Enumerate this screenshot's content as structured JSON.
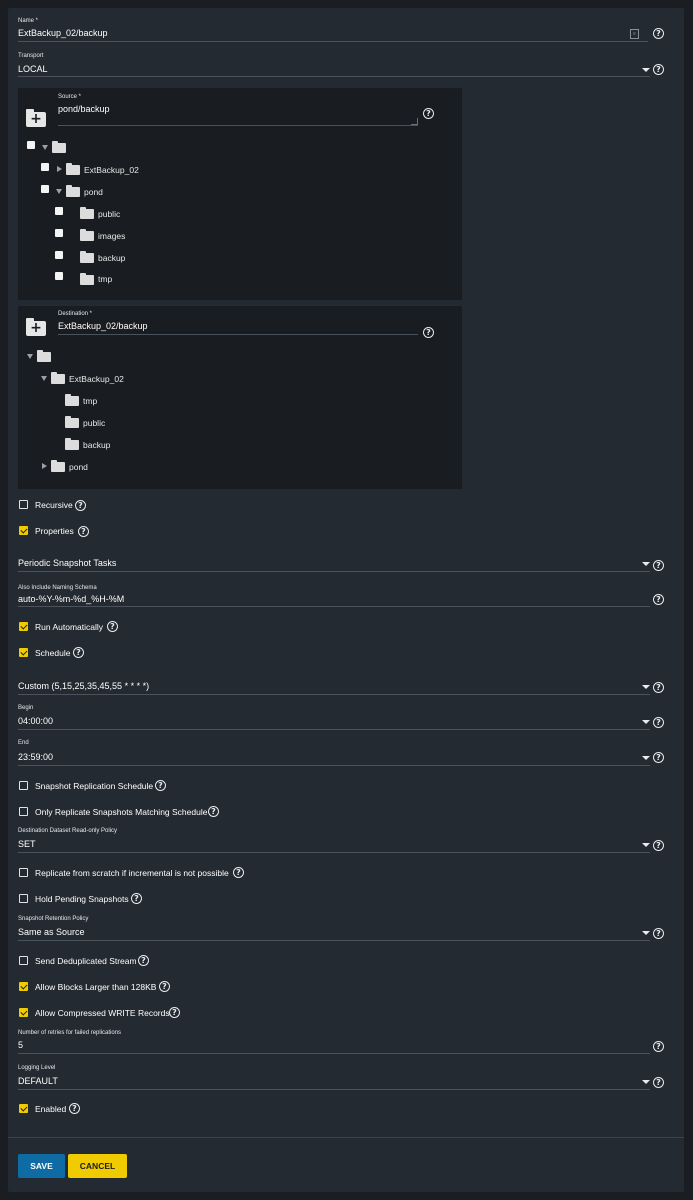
{
  "name": {
    "label": "Name *",
    "value": "ExtBackup_02/backup"
  },
  "transport": {
    "label": "Transport",
    "value": "LOCAL"
  },
  "source": {
    "label": "Source *",
    "value": "pond/backup",
    "tree": {
      "items": [
        "ExtBackup_02",
        "pond",
        "public",
        "images",
        "backup",
        "tmp"
      ]
    }
  },
  "destination": {
    "label": "Destination *",
    "value": "ExtBackup_02/backup",
    "tree": {
      "items": [
        "ExtBackup_02",
        "tmp",
        "public",
        "backup",
        "pond"
      ]
    }
  },
  "recursive": {
    "label": "Recursive",
    "checked": false
  },
  "properties": {
    "label": "Properties",
    "checked": true
  },
  "periodic_snapshot_tasks": {
    "placeholder": "Periodic Snapshot Tasks"
  },
  "naming_schema": {
    "label": "Also Include Naming Schema",
    "value": "auto-%Y-%m-%d_%H-%M"
  },
  "run_automatically": {
    "label": "Run Automatically",
    "checked": true
  },
  "schedule": {
    "label": "Schedule",
    "checked": true
  },
  "schedule_preset": {
    "value": "Custom (5,15,25,35,45,55 * * * *)"
  },
  "begin": {
    "label": "Begin",
    "value": "04:00:00"
  },
  "end": {
    "label": "End",
    "value": "23:59:00"
  },
  "snapshot_replication_schedule": {
    "label": "Snapshot Replication Schedule",
    "checked": false
  },
  "only_replicate_matching": {
    "label": "Only Replicate Snapshots Matching Schedule",
    "checked": false
  },
  "readonly_policy": {
    "label": "Destination Dataset Read-only Policy",
    "value": "SET"
  },
  "replicate_from_scratch": {
    "label": "Replicate from scratch if incremental is not possible",
    "checked": false
  },
  "hold_pending": {
    "label": "Hold Pending Snapshots",
    "checked": false
  },
  "retention_policy": {
    "label": "Snapshot Retention Policy",
    "value": "Same as Source"
  },
  "send_dedup": {
    "label": "Send Deduplicated Stream",
    "checked": false
  },
  "allow_large_blocks": {
    "label": "Allow Blocks Larger than 128KB",
    "checked": true
  },
  "allow_compressed": {
    "label": "Allow Compressed WRITE Records",
    "checked": true
  },
  "retries": {
    "label": "Number of retries for failed replications",
    "value": "5"
  },
  "logging_level": {
    "label": "Logging Level",
    "value": "DEFAULT"
  },
  "enabled": {
    "label": "Enabled",
    "checked": true
  },
  "buttons": {
    "save": "SAVE",
    "cancel": "CANCEL"
  },
  "colors": {
    "accent": "#f0cb00",
    "primary": "#0f6ba3",
    "background": "#232a31"
  },
  "icons": {
    "help": "help-circle-icon",
    "dropdown": "caret-down-icon",
    "folder": "folder-icon",
    "add_folder": "folder-plus-icon"
  }
}
